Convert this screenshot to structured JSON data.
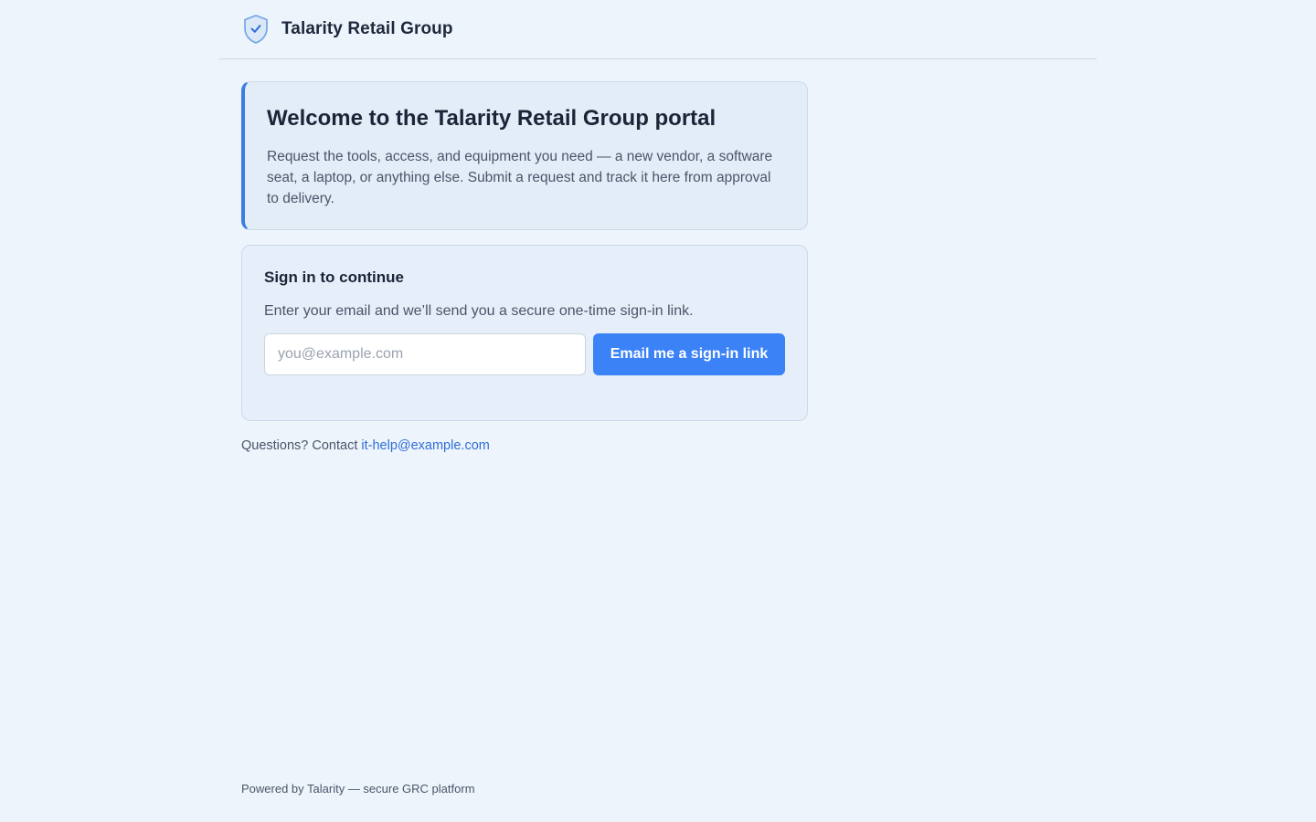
{
  "header": {
    "brand_name": "Talarity Retail Group",
    "logo_icon": "shield-check-icon"
  },
  "welcome": {
    "title": "Welcome to the Talarity Retail Group portal",
    "body": "Request the tools, access, and equipment you need — a new vendor, a software seat, a laptop, or anything else. Submit a request and track it here from approval to delivery."
  },
  "signin": {
    "title": "Sign in to continue",
    "description": "Enter your email and we’ll send you a secure one-time sign-in link.",
    "email_placeholder": "you@example.com",
    "email_value": "",
    "button_label": "Email me a sign-in link"
  },
  "contact": {
    "prefix": "Questions? Contact",
    "email": "it-help@example.com"
  },
  "footer": {
    "text": "Powered by Talarity — secure GRC platform"
  },
  "colors": {
    "background": "#eef4fc",
    "accent": "#3b82f6",
    "link": "#2f6fd6",
    "card_border_accent": "#3b7de0"
  }
}
